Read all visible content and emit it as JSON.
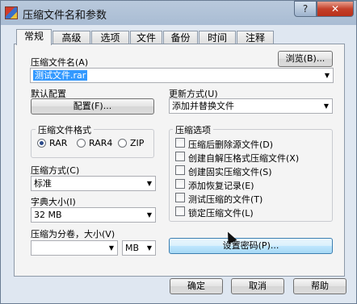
{
  "window": {
    "title": "压缩文件名和参数",
    "help_glyph": "?",
    "close_glyph": "✕"
  },
  "tabs": [
    "常规",
    "高级",
    "选项",
    "文件",
    "备份",
    "时间",
    "注释"
  ],
  "archive": {
    "label": "压缩文件名(A)",
    "browse_label": "浏览(B)...",
    "value": "测试文件.rar"
  },
  "profile": {
    "label": "默认配置",
    "button_label": "配置(F)..."
  },
  "update": {
    "label": "更新方式(U)",
    "value": "添加并替换文件"
  },
  "format": {
    "group_label": "压缩文件格式",
    "options": [
      "RAR",
      "RAR4",
      "ZIP"
    ],
    "selected": "RAR"
  },
  "method": {
    "label": "压缩方式(C)",
    "value": "标准"
  },
  "dictionary": {
    "label": "字典大小(I)",
    "value": "32 MB"
  },
  "split": {
    "label": "压缩为分卷，大小(V)",
    "value": "",
    "unit": "MB"
  },
  "archive_options": {
    "group_label": "压缩选项",
    "items": [
      "压缩后删除源文件(D)",
      "创建自解压格式压缩文件(X)",
      "创建固实压缩文件(S)",
      "添加恢复记录(E)",
      "测试压缩的文件(T)",
      "锁定压缩文件(L)"
    ]
  },
  "password_button": "设置密码(P)...",
  "footer": {
    "ok": "确定",
    "cancel": "取消",
    "help": "帮助"
  },
  "colors": {
    "selection": "#3399ff",
    "close_button": "#c4412b",
    "title_bar": "#b9c9dc"
  }
}
